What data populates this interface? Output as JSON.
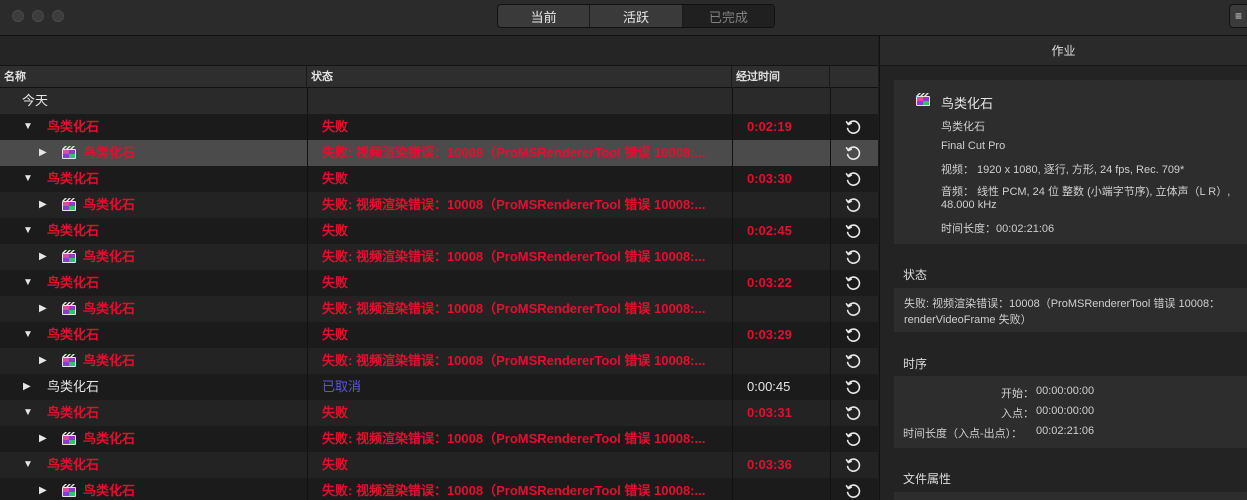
{
  "toolbar": {
    "tabs": [
      {
        "label": "当前",
        "active": false
      },
      {
        "label": "活跃",
        "active": false
      },
      {
        "label": "已完成",
        "active": true
      }
    ],
    "corner_button": "≡"
  },
  "table": {
    "columns": [
      "名称",
      "状态",
      "经过时间"
    ],
    "group_label": "今天",
    "rows": [
      {
        "level": 0,
        "expanded": true,
        "name": "鸟类化石",
        "status": "失败",
        "time": "0:02:19",
        "style": "failed"
      },
      {
        "level": 1,
        "expanded": false,
        "name": "鸟类化石",
        "status": "失败: 视频渲染错误：10008（ProMSRendererTool 错误 10008:...",
        "time": "",
        "style": "failed",
        "selected": true
      },
      {
        "level": 0,
        "expanded": true,
        "name": "鸟类化石",
        "status": "失败",
        "time": "0:03:30",
        "style": "failed"
      },
      {
        "level": 1,
        "expanded": false,
        "name": "鸟类化石",
        "status": "失败: 视频渲染错误：10008（ProMSRendererTool 错误 10008:...",
        "time": "",
        "style": "failed"
      },
      {
        "level": 0,
        "expanded": true,
        "name": "鸟类化石",
        "status": "失败",
        "time": "0:02:45",
        "style": "failed"
      },
      {
        "level": 1,
        "expanded": false,
        "name": "鸟类化石",
        "status": "失败: 视频渲染错误：10008（ProMSRendererTool 错误 10008:...",
        "time": "",
        "style": "failed"
      },
      {
        "level": 0,
        "expanded": true,
        "name": "鸟类化石",
        "status": "失败",
        "time": "0:03:22",
        "style": "failed"
      },
      {
        "level": 1,
        "expanded": false,
        "name": "鸟类化石",
        "status": "失败: 视频渲染错误：10008（ProMSRendererTool 错误 10008:...",
        "time": "",
        "style": "failed"
      },
      {
        "level": 0,
        "expanded": true,
        "name": "鸟类化石",
        "status": "失败",
        "time": "0:03:29",
        "style": "failed"
      },
      {
        "level": 1,
        "expanded": false,
        "name": "鸟类化石",
        "status": "失败: 视频渲染错误：10008（ProMSRendererTool 错误 10008:...",
        "time": "",
        "style": "failed"
      },
      {
        "level": 0,
        "expanded": false,
        "name": "鸟类化石",
        "status": "已取消",
        "time": "0:00:45",
        "style": "cancelled"
      },
      {
        "level": 0,
        "expanded": true,
        "name": "鸟类化石",
        "status": "失败",
        "time": "0:03:31",
        "style": "failed"
      },
      {
        "level": 1,
        "expanded": false,
        "name": "鸟类化石",
        "status": "失败: 视频渲染错误：10008（ProMSRendererTool 错误 10008:...",
        "time": "",
        "style": "failed"
      },
      {
        "level": 0,
        "expanded": true,
        "name": "鸟类化石",
        "status": "失败",
        "time": "0:03:36",
        "style": "failed"
      },
      {
        "level": 1,
        "expanded": false,
        "name": "鸟类化石",
        "status": "失败: 视频渲染错误：10008（ProMSRendererTool 错误 10008:...",
        "time": "",
        "style": "failed"
      }
    ]
  },
  "inspector": {
    "header": "作业",
    "job": {
      "title": "鸟类化石",
      "subtitle": "鸟类化石",
      "app": "Final Cut Pro",
      "video": "视频： 1920 x 1080, 逐行, 方形, 24 fps, Rec. 709*",
      "audio_line1": "音频： 线性 PCM, 24 位 整数 (小端字节序), 立体声（L R）,",
      "audio_line2": "48.000 kHz",
      "duration": "时间长度：00:02:21:06"
    },
    "status": {
      "title": "状态",
      "line1": "失败: 视频渲染错误：10008（ProMSRendererTool 错误 10008：",
      "line2": "renderVideoFrame 失败）"
    },
    "timing": {
      "title": "时序",
      "start_label": "开始：",
      "start_value": "00:00:00:00",
      "in_label": "入点：",
      "in_value": "00:00:00:00",
      "dur_label": "时间长度（入点-出点）：",
      "dur_value": "00:02:21:06"
    },
    "file_props": {
      "title": "文件属性"
    }
  },
  "colors": {
    "failed": "#e0102f",
    "cancelled": "#5b55e0",
    "selected_row": "#4b4b4b"
  }
}
